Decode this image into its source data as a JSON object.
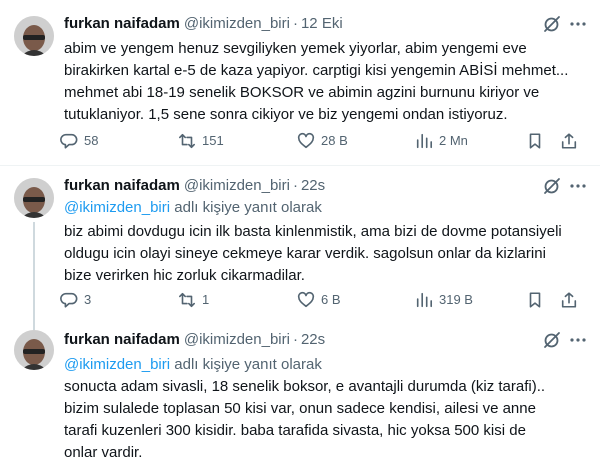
{
  "tweets": [
    {
      "name": "furkan naifadam",
      "handle": "@ikimizden_biri",
      "dot": "·",
      "time": "12 Eki",
      "reply_prefix": "",
      "reply_suffix": "",
      "text": "abim ve yengem henuz sevgiliyken yemek yiyorlar, abim yengemi eve\nbirakirken kartal e-5 de kaza yapiyor. carptigi kisi yengemin ABİSİ mehmet...\nmehmet abi 18-19 senelik BOKSOR ve abimin agzini burnunu kiriyor ve\ntutuklaniyor. 1,5 sene sonra cikiyor ve biz yengemi ondan istiyoruz.",
      "replies": "58",
      "retweets": "151",
      "likes": "28 B",
      "views": "2 Mn"
    },
    {
      "name": "furkan naifadam",
      "handle": "@ikimizden_biri",
      "dot": "·",
      "time": "22s",
      "reply_prefix": "@ikimizden_biri",
      "reply_suffix": " adlı kişiye yanıt olarak",
      "text": "biz abimi dovdugu icin ilk basta kinlenmistik, ama bizi de dovme potansiyeli\noldugu icin olayi sineye cekmeye karar verdik. sagolsun onlar da kizlarini\nbize verirken hic zorluk cikarmadilar.",
      "replies": "3",
      "retweets": "1",
      "likes": "6 B",
      "views": "319 B"
    },
    {
      "name": "furkan naifadam",
      "handle": "@ikimizden_biri",
      "dot": "·",
      "time": "22s",
      "reply_prefix": "@ikimizden_biri",
      "reply_suffix": " adlı kişiye yanıt olarak",
      "text": "sonucta adam sivasli, 18 senelik boksor, e avantajli durumda (kiz tarafi)..\nbizim sulalede toplasan 50 kisi var, onun sadece kendisi, ailesi ve anne\ntarafi kuzenleri 300 kisidir. baba tarafida sivasta, hic yoksa 500 kisi de\nonlar vardir."
    }
  ],
  "icons": {
    "grok": "grok-icon",
    "more": "more-icon",
    "reply": "reply-icon",
    "retweet": "retweet-icon",
    "like": "like-icon",
    "views": "views-icon",
    "bookmark": "bookmark-icon",
    "share": "share-icon"
  },
  "colors": {
    "mention": "#1d9bf0",
    "secondary": "#536471",
    "text": "#0f1419"
  }
}
